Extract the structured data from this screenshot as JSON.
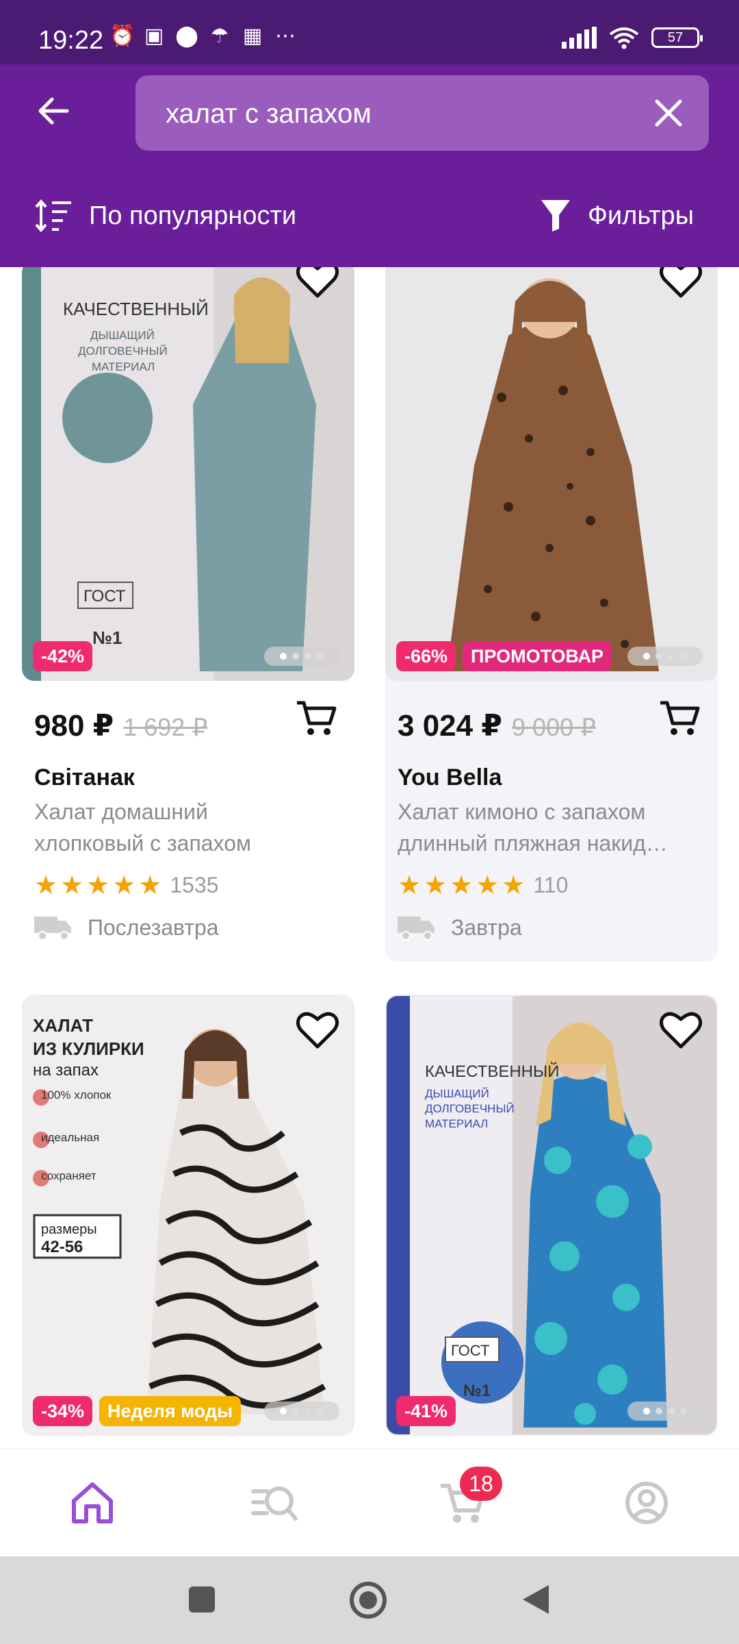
{
  "status": {
    "time": "19:22",
    "battery": "57"
  },
  "search": {
    "query": "халат с запахом"
  },
  "sort": {
    "label": "По популярности"
  },
  "filter": {
    "label": "Фильтры"
  },
  "products": [
    {
      "price": "980 ₽",
      "old_price": "1 692 ₽",
      "brand": "Світанак",
      "desc1": "Халат домашний",
      "desc2": "хлопковый с запахом",
      "reviews": "1535",
      "delivery": "Послезавтра",
      "badges": [
        "-42%"
      ]
    },
    {
      "price": "3 024 ₽",
      "old_price": "9 000 ₽",
      "brand": "You Bella",
      "desc1": "Халат кимоно с запахом",
      "desc2": "длинный пляжная накид…",
      "reviews": "110",
      "delivery": "Завтра",
      "badges": [
        "-66%",
        "ПРОМОТОВАР"
      ]
    },
    {
      "badges": [
        "-34%",
        "Неделя моды"
      ]
    },
    {
      "badges": [
        "-41%"
      ]
    }
  ],
  "nav": {
    "cart_count": "18"
  },
  "colors": {
    "header": "#6a1e99",
    "status": "#4b1a73",
    "discount": "#ef2a6e",
    "accent_purple": "#9b4dd6"
  }
}
